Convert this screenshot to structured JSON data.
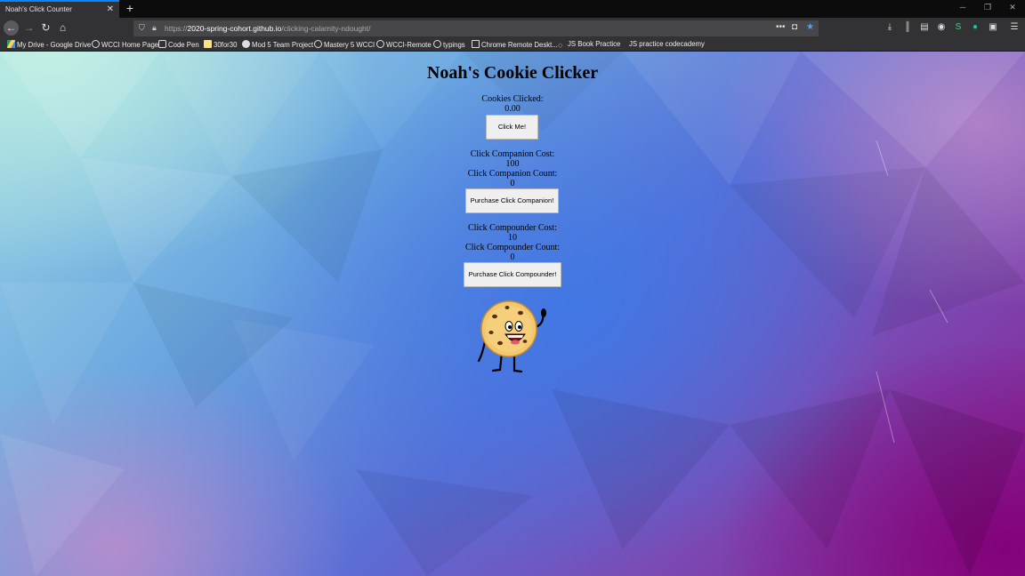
{
  "browser": {
    "tab_title": "Noah's Click Counter",
    "url_prefix": "https://",
    "url_host": "2020-spring-cohort.github.io",
    "url_path": "/clicking-calamity-ndought/",
    "new_tab": "+",
    "bookmarks": [
      "My Drive - Google Drive",
      "WCCI Home Page",
      "Code Pen",
      "30for30",
      "Mod 5 Team Project",
      "Mastery 5 WCCI",
      "WCCI-Remote",
      "typings",
      "Chrome Remote Deskt...",
      "JS Book Practice",
      "JS practice codecademy"
    ]
  },
  "page": {
    "title": "Noah's Cookie Clicker",
    "cookies_label": "Cookies Clicked:",
    "cookies_value": "0.00",
    "click_button": "Click Me!",
    "companion_cost_label": "Click Companion Cost:",
    "companion_cost_value": "100",
    "companion_count_label": "Click Companion Count:",
    "companion_count_value": "0",
    "companion_button": "Purchase Click Companion!",
    "compounder_cost_label": "Click Compounder Cost:",
    "compounder_cost_value": "10",
    "compounder_count_label": "Click Compounder Count:",
    "compounder_count_value": "0",
    "compounder_button": "Purchase Click Compounder!"
  }
}
